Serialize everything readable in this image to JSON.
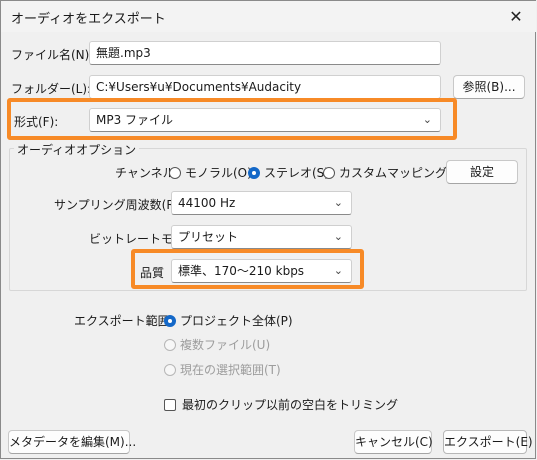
{
  "dialog": {
    "title": "オーディオをエクスポート",
    "close_symbol": "✕"
  },
  "file": {
    "filename_label": "ファイル名(N):",
    "filename_value": "無題.mp3",
    "folder_label": "フォルダー(L):",
    "folder_value": "C:¥Users¥u¥Documents¥Audacity",
    "browse_button": "参照(B)...",
    "format_label": "形式(F):",
    "format_value": "MP3 ファイル"
  },
  "audio_options": {
    "group_title": "オーディオオプション",
    "channels_label": "チャンネル",
    "channel_options": [
      {
        "label": "モノラル(O)",
        "selected": false
      },
      {
        "label": "ステレオ(S)",
        "selected": true
      },
      {
        "label": "カスタムマッピング(G)",
        "selected": false
      }
    ],
    "settings_button": "設定",
    "sample_rate_label": "サンプリング周波数(R)",
    "sample_rate_value": "44100 Hz",
    "bitrate_mode_label": "ビットレートモード",
    "bitrate_mode_value": "プリセット",
    "quality_label": "品質",
    "quality_value": "標準、170〜210 kbps"
  },
  "export_range": {
    "label": "エクスポート範囲:",
    "options": [
      {
        "label": "プロジェクト全体(P)",
        "selected": true,
        "enabled": true
      },
      {
        "label": "複数ファイル(U)",
        "selected": false,
        "enabled": false
      },
      {
        "label": "現在の選択範囲(T)",
        "selected": false,
        "enabled": false
      }
    ],
    "trim_checkbox_label": "最初のクリップ以前の空白をトリミング",
    "trim_checked": false
  },
  "footer": {
    "metadata_button": "メタデータを編集(M)...",
    "cancel_button": "キャンセル(C)",
    "export_button": "エクスポート(E)"
  },
  "colors": {
    "highlight": "#f78a27",
    "accent": "#1468c8"
  }
}
